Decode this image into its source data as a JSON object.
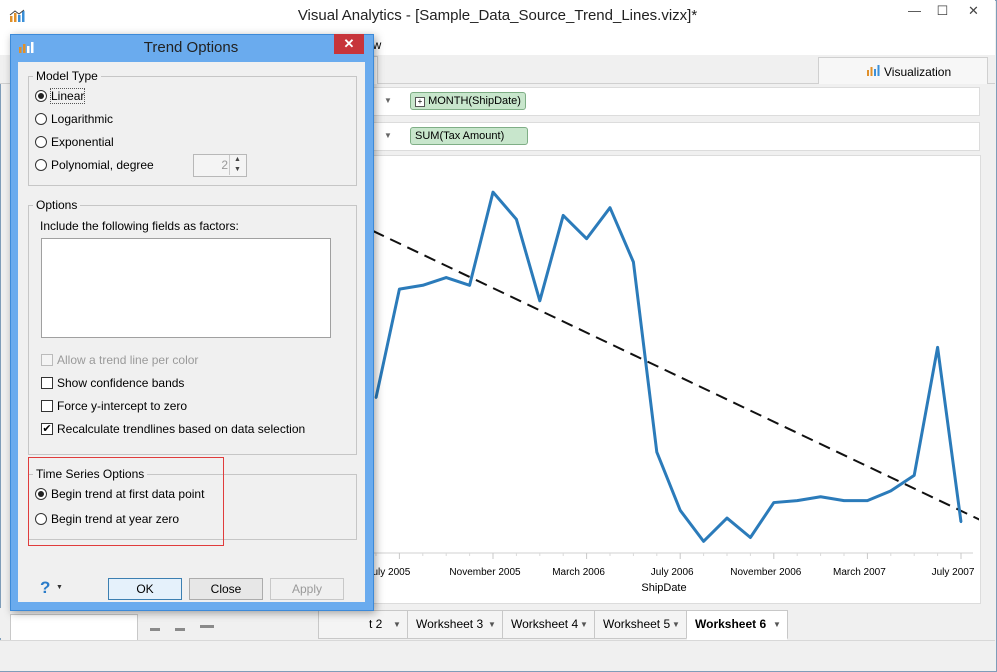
{
  "window": {
    "title": "Visual Analytics - [Sample_Data_Source_Trend_Lines.vizx]*",
    "minimize": "—",
    "maximize": "☐",
    "close": "✕"
  },
  "menu": {
    "partial_item": "ow"
  },
  "tabs": {
    "visualization": "Visualization"
  },
  "shelves": {
    "columns_pill": "MONTH(ShipDate)",
    "rows_pill": "SUM(Tax Amount)",
    "pill_expand": "+"
  },
  "chart_data": {
    "type": "line",
    "xlabel": "ShipDate",
    "x_ticks": [
      "uly 2005",
      "November 2005",
      "March 2006",
      "July 2006",
      "November 2006",
      "March 2007",
      "July 2007"
    ],
    "x": [
      "2005-06",
      "2005-07",
      "2005-08",
      "2005-09",
      "2005-10",
      "2005-11",
      "2005-12",
      "2006-01",
      "2006-02",
      "2006-03",
      "2006-04",
      "2006-05",
      "2006-06",
      "2006-07",
      "2006-08",
      "2006-09",
      "2006-10",
      "2006-11",
      "2006-12",
      "2007-01",
      "2007-02",
      "2007-03",
      "2007-04",
      "2007-05",
      "2007-06",
      "2007-07",
      "2007-08"
    ],
    "series": [
      {
        "values": [
          0.4,
          0.68,
          0.69,
          0.71,
          0.69,
          0.93,
          0.86,
          0.65,
          0.87,
          0.81,
          0.89,
          0.75,
          0.26,
          0.11,
          0.03,
          0.09,
          0.04,
          0.13,
          0.135,
          0.145,
          0.135,
          0.135,
          0.16,
          0.2,
          0.53,
          0.08
        ]
      },
      {
        "type": "trend",
        "style": "dashed",
        "color": "#111111",
        "start": 0.83,
        "end": 0.08
      }
    ],
    "color": "#2b7bba",
    "grid": false
  },
  "sheet_tabs": [
    {
      "label": "t 2"
    },
    {
      "label": "Worksheet 3"
    },
    {
      "label": "Worksheet 4"
    },
    {
      "label": "Worksheet 5"
    },
    {
      "label": "Worksheet 6",
      "active": true
    }
  ],
  "dialog": {
    "title": "Trend Options",
    "close": "✕",
    "model_type": {
      "title": "Model Type",
      "options": [
        {
          "label": "Linear",
          "selected": true
        },
        {
          "label": "Logarithmic",
          "selected": false
        },
        {
          "label": "Exponential",
          "selected": false
        },
        {
          "label": "Polynomial, degree",
          "selected": false
        }
      ],
      "degree": "2"
    },
    "options": {
      "title": "Options",
      "factors_label": "Include the following fields as factors:",
      "checkboxes": [
        {
          "label": "Allow a trend line per color",
          "checked": false,
          "disabled": true
        },
        {
          "label": "Show confidence bands",
          "checked": false
        },
        {
          "label": "Force y-intercept to zero",
          "checked": false
        },
        {
          "label": "Recalculate trendlines based on data selection",
          "checked": true
        }
      ]
    },
    "time_series": {
      "title": "Time Series Options",
      "options": [
        {
          "label": "Begin trend at first data point",
          "selected": true
        },
        {
          "label": "Begin trend at year zero",
          "selected": false
        }
      ]
    },
    "buttons": {
      "help": "?",
      "ok": "OK",
      "close": "Close",
      "apply": "Apply"
    }
  }
}
